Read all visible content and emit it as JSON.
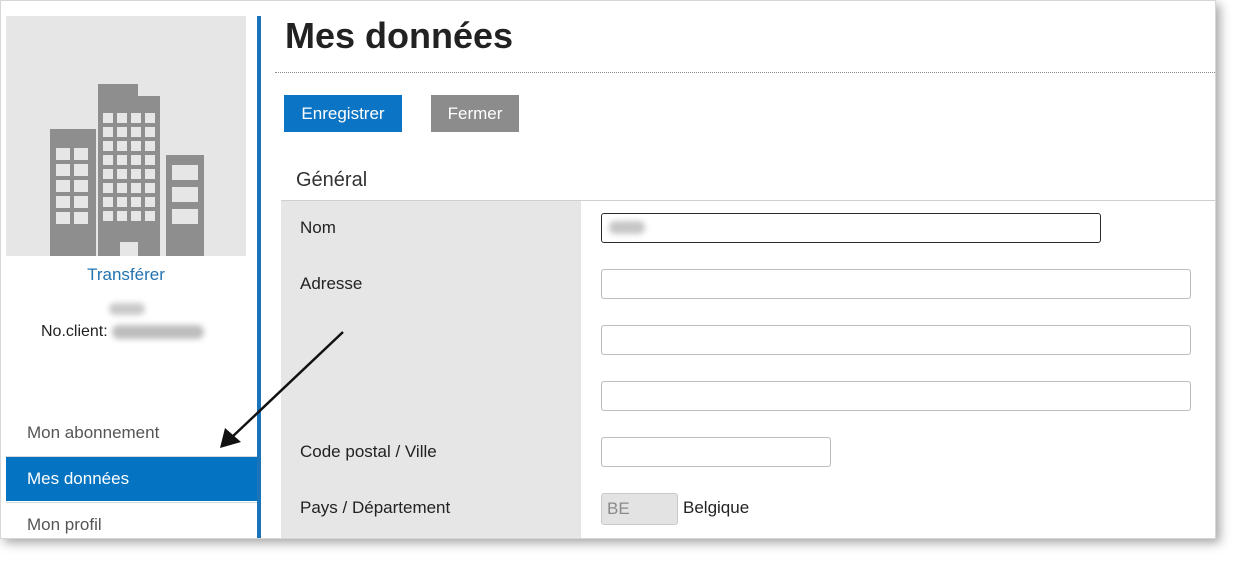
{
  "sidebar": {
    "transfer_label": "Transférer",
    "client_label": "No.client:",
    "nav": [
      {
        "label": "Mon abonnement",
        "active": false
      },
      {
        "label": "Mes données",
        "active": true
      },
      {
        "label": "Mon profil",
        "active": false
      }
    ]
  },
  "main": {
    "title": "Mes données",
    "buttons": {
      "save": "Enregistrer",
      "close": "Fermer"
    },
    "section": "Général",
    "fields": {
      "name_label": "Nom",
      "address_label": "Adresse",
      "postal_label": "Code postal / Ville",
      "country_label": "Pays / Département",
      "country_code": "BE",
      "country_name": "Belgique"
    }
  },
  "colors": {
    "accent": "#0373c2",
    "sidebar_border": "#1b73b8",
    "close_button": "#8c8c8c",
    "label_column": "#e6e6e6"
  }
}
